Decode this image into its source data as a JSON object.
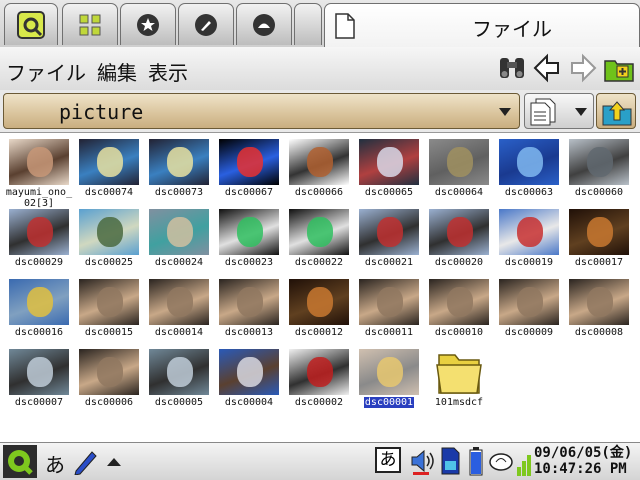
{
  "tabs": [
    {
      "icon": "settings-icon"
    },
    {
      "icon": "apps-grid-icon"
    },
    {
      "icon": "star-icon"
    },
    {
      "icon": "pen-icon"
    },
    {
      "icon": "media-icon"
    },
    {
      "icon": ""
    }
  ],
  "active_tab": {
    "title": "ファイル",
    "icon": "document-icon"
  },
  "menu": {
    "file": "ファイル",
    "edit": "編集",
    "view": "表示"
  },
  "toolbar": [
    "binoculars-icon",
    "back-arrow-icon",
    "forward-arrow-icon",
    "new-folder-icon"
  ],
  "path": {
    "current": "picture"
  },
  "files": [
    {
      "name": "mayumi_ono_\n02[3]",
      "thumb": "portrait"
    },
    {
      "name": "dsc00074",
      "thumb": "penguin"
    },
    {
      "name": "dsc00073",
      "thumb": "penguin"
    },
    {
      "name": "dsc00067",
      "thumb": "apple"
    },
    {
      "name": "dsc00066",
      "thumb": "cartoon"
    },
    {
      "name": "dsc00065",
      "thumb": "penguins"
    },
    {
      "name": "dsc00064",
      "thumb": "gray"
    },
    {
      "name": "dsc00063",
      "thumb": "xp"
    },
    {
      "name": "dsc00060",
      "thumb": "harbor"
    },
    {
      "name": "dsc00029",
      "thumb": "heroes"
    },
    {
      "name": "dsc00025",
      "thumb": "plane"
    },
    {
      "name": "dsc00024",
      "thumb": "figures"
    },
    {
      "name": "dsc00023",
      "thumb": "hero-dark"
    },
    {
      "name": "dsc00022",
      "thumb": "hero-dark"
    },
    {
      "name": "dsc00021",
      "thumb": "heroes"
    },
    {
      "name": "dsc00020",
      "thumb": "heroes"
    },
    {
      "name": "dsc00019",
      "thumb": "mask"
    },
    {
      "name": "dsc00017",
      "thumb": "sunset"
    },
    {
      "name": "dsc00016",
      "thumb": "title"
    },
    {
      "name": "dsc00015",
      "thumb": "scene"
    },
    {
      "name": "dsc00014",
      "thumb": "scene"
    },
    {
      "name": "dsc00013",
      "thumb": "scene"
    },
    {
      "name": "dsc00012",
      "thumb": "sunset"
    },
    {
      "name": "dsc00011",
      "thumb": "scene"
    },
    {
      "name": "dsc00010",
      "thumb": "scene"
    },
    {
      "name": "dsc00009",
      "thumb": "scene"
    },
    {
      "name": "dsc00008",
      "thumb": "scene"
    },
    {
      "name": "dsc00007",
      "thumb": "sky"
    },
    {
      "name": "dsc00006",
      "thumb": "scene"
    },
    {
      "name": "dsc00005",
      "thumb": "sky"
    },
    {
      "name": "dsc00004",
      "thumb": "city"
    },
    {
      "name": "dsc00002",
      "thumb": "car"
    },
    {
      "name": "dsc00001",
      "thumb": "coins",
      "selected": true
    },
    {
      "name": "101msdcf",
      "thumb": "folder"
    }
  ],
  "taskbar": {
    "ime_mode": "あ",
    "ime_indicator": "あ",
    "date": "09/06/05(金)",
    "time": "10:47:26 PM"
  },
  "colors": {
    "selection": "#2a3fbf",
    "path_bar": "#d9c39b",
    "folder": "#e8d040"
  }
}
